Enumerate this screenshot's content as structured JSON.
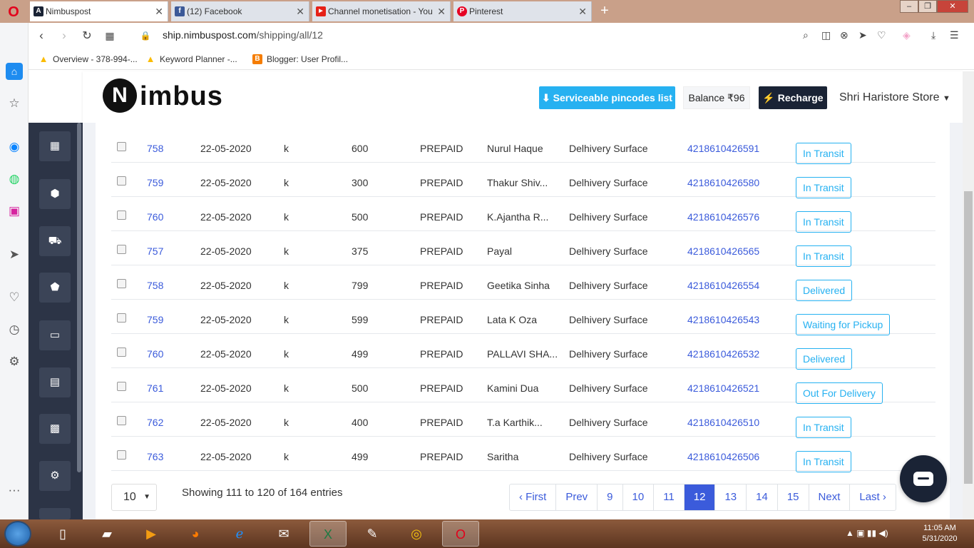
{
  "browser": {
    "tabs": [
      {
        "title": "Nimbuspost",
        "fav": "A",
        "fav_color": "#1a2335",
        "active": true
      },
      {
        "title": "(12) Facebook",
        "fav": "f",
        "fav_color": "#3b5998",
        "active": false
      },
      {
        "title": "Channel monetisation - You",
        "fav": "▶",
        "fav_color": "#e62117",
        "active": false
      },
      {
        "title": "Pinterest",
        "fav": "P",
        "fav_color": "#e60023",
        "active": false
      }
    ],
    "url_host": "ship.nimbuspost.com",
    "url_path": "/shipping/all/12",
    "bookmarks": [
      {
        "label": "Overview - 378-994-...",
        "fav": "▲",
        "fav_color": "#fbbc04"
      },
      {
        "label": "Keyword Planner -...",
        "fav": "▲",
        "fav_color": "#fbbc04"
      },
      {
        "label": "Blogger: User Profil...",
        "fav": "B",
        "fav_color": "#f57d00"
      }
    ]
  },
  "header": {
    "logo_text": "imbus",
    "logo_mark": "N",
    "pincodes_label": "⬇ Serviceable pincodes list",
    "balance_label": "Balance ₹96",
    "recharge_label": "⚡ Recharge",
    "store_name": "Shri Haristore Store"
  },
  "table": {
    "rows": [
      {
        "id": "758",
        "date": "22-05-2020",
        "product": "k",
        "amount": "600",
        "payment": "PREPAID",
        "customer": "Nurul Haque",
        "courier": "Delhivery Surface",
        "awb": "4218610426591",
        "status": "In Transit"
      },
      {
        "id": "759",
        "date": "22-05-2020",
        "product": "k",
        "amount": "300",
        "payment": "PREPAID",
        "customer": "Thakur Shiv...",
        "courier": "Delhivery Surface",
        "awb": "4218610426580",
        "status": "In Transit"
      },
      {
        "id": "760",
        "date": "22-05-2020",
        "product": "k",
        "amount": "500",
        "payment": "PREPAID",
        "customer": "K.Ajantha R...",
        "courier": "Delhivery Surface",
        "awb": "4218610426576",
        "status": "In Transit"
      },
      {
        "id": "757",
        "date": "22-05-2020",
        "product": "k",
        "amount": "375",
        "payment": "PREPAID",
        "customer": "Payal",
        "courier": "Delhivery Surface",
        "awb": "4218610426565",
        "status": "In Transit"
      },
      {
        "id": "758",
        "date": "22-05-2020",
        "product": "k",
        "amount": "799",
        "payment": "PREPAID",
        "customer": "Geetika Sinha",
        "courier": "Delhivery Surface",
        "awb": "4218610426554",
        "status": "Delivered"
      },
      {
        "id": "759",
        "date": "22-05-2020",
        "product": "k",
        "amount": "599",
        "payment": "PREPAID",
        "customer": "Lata K Oza",
        "courier": "Delhivery Surface",
        "awb": "4218610426543",
        "status": "Waiting for Pickup"
      },
      {
        "id": "760",
        "date": "22-05-2020",
        "product": "k",
        "amount": "499",
        "payment": "PREPAID",
        "customer": "PALLAVI SHA...",
        "courier": "Delhivery Surface",
        "awb": "4218610426532",
        "status": "Delivered"
      },
      {
        "id": "761",
        "date": "22-05-2020",
        "product": "k",
        "amount": "500",
        "payment": "PREPAID",
        "customer": "Kamini Dua",
        "courier": "Delhivery Surface",
        "awb": "4218610426521",
        "status": "Out For Delivery"
      },
      {
        "id": "762",
        "date": "22-05-2020",
        "product": "k",
        "amount": "400",
        "payment": "PREPAID",
        "customer": "T.a Karthik...",
        "courier": "Delhivery Surface",
        "awb": "4218610426510",
        "status": "In Transit"
      },
      {
        "id": "763",
        "date": "22-05-2020",
        "product": "k",
        "amount": "499",
        "payment": "PREPAID",
        "customer": "Saritha",
        "courier": "Delhivery Surface",
        "awb": "4218610426506",
        "status": "In Transit"
      }
    ]
  },
  "footer": {
    "per_page": "10",
    "entries_text": "Showing 111 to 120 of 164 entries",
    "pages": [
      "‹ First",
      "Prev",
      "9",
      "10",
      "11",
      "12",
      "13",
      "14",
      "15",
      "Next",
      "Last ›"
    ],
    "active_page": "12"
  },
  "taskbar": {
    "time": "11:05 AM",
    "date": "5/31/2020"
  },
  "colors": {
    "accent": "#26b1f1",
    "link": "#3b5bdb",
    "dark": "#1a2335"
  }
}
